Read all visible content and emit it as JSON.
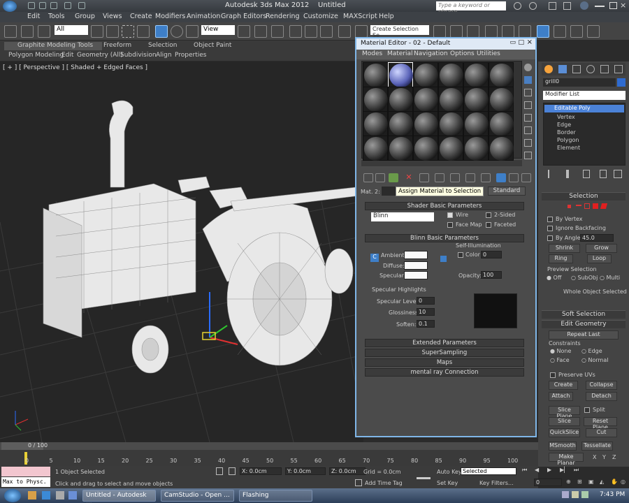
{
  "app": {
    "title": "Autodesk 3ds Max 2012",
    "doc": "Untitled",
    "search_placeholder": "Type a keyword or phrase"
  },
  "menu": [
    "Edit",
    "Tools",
    "Group",
    "Views",
    "Create",
    "Modifiers",
    "Animation",
    "Graph Editors",
    "Rendering",
    "Customize",
    "MAXScript",
    "Help"
  ],
  "toolbar": {
    "filter": "All",
    "refcoord": "View",
    "selection_set": "Create Selection Se"
  },
  "ribbon": {
    "tabs": [
      "Graphite Modeling Tools",
      "Freeform",
      "Selection",
      "Object Paint"
    ],
    "subtabs": [
      "Polygon Modeling",
      "Edit",
      "Geometry (All)",
      "Subdivision",
      "Align",
      "Properties"
    ]
  },
  "viewport": {
    "label": "[ + ] [ Perspective ] [ Shaded + Edged Faces ]"
  },
  "material_editor": {
    "title": "Material Editor - 02 - Default",
    "menu": [
      "Modes",
      "Material",
      "Navigation",
      "Options",
      "Utilities"
    ],
    "tooltip": "Assign Material to Selection",
    "mat_label": "Mat. 2:",
    "type_button": "Standard",
    "shader_basic": {
      "title": "Shader Basic Parameters",
      "shader": "Blinn",
      "wire": "Wire",
      "two_sided": "2-Sided",
      "face_map": "Face Map",
      "faceted": "Faceted"
    },
    "blinn": {
      "title": "Blinn Basic Parameters",
      "self_illum": "Self-Illumination",
      "color": "Color",
      "color_value": "0",
      "ambient": "Ambient:",
      "diffuse": "Diffuse:",
      "specular": "Specular:",
      "opacity": "Opacity:",
      "opacity_value": "100",
      "c_lock": "C"
    },
    "spec_highlights": {
      "title": "Specular Highlights",
      "level": "Specular Level:",
      "level_value": "0",
      "gloss": "Glossiness:",
      "gloss_value": "10",
      "soften": "Soften:",
      "soften_value": "0.1"
    },
    "rollouts": [
      "Extended Parameters",
      "SuperSampling",
      "Maps",
      "mental ray Connection"
    ]
  },
  "command_panel": {
    "object_name": "grill0",
    "modifier_list": "Modifier List",
    "stack": [
      "Editable Poly",
      "Vertex",
      "Edge",
      "Border",
      "Polygon",
      "Element"
    ],
    "selection": "Selection",
    "by_vertex": "By Vertex",
    "ignore_backfacing": "Ignore Backfacing",
    "by_angle": "By Angle:",
    "by_angle_value": "45.0",
    "shrink": "Shrink",
    "grow": "Grow",
    "ring": "Ring",
    "loop": "Loop",
    "preview_selection": "Preview Selection",
    "off": "Off",
    "subobj": "SubObj",
    "multi": "Multi",
    "whole_selected": "Whole Object Selected",
    "soft_selection": "Soft Selection",
    "edit_geometry": "Edit Geometry",
    "repeat_last": "Repeat Last",
    "constraints": "Constraints",
    "none": "None",
    "edge": "Edge",
    "face": "Face",
    "normal": "Normal",
    "preserve_uvs": "Preserve UVs",
    "create": "Create",
    "collapse": "Collapse",
    "attach": "Attach",
    "detach": "Detach",
    "slice_plane": "Slice Plane",
    "split": "Split",
    "slice": "Slice",
    "reset_plane": "Reset Plane",
    "quickslice": "QuickSlice",
    "cut": "Cut",
    "msmooth": "MSmooth",
    "tessellate": "Tessellate",
    "make_planar": "Make Planar",
    "x": "X",
    "y": "Y",
    "z": "Z"
  },
  "timeline": {
    "frame": "0 / 100",
    "ticks": [
      "0",
      "5",
      "10",
      "15",
      "20",
      "25",
      "30",
      "35",
      "40",
      "45",
      "50",
      "55",
      "60",
      "65",
      "70",
      "75",
      "80",
      "85",
      "90",
      "95",
      "100"
    ]
  },
  "status": {
    "maxscript": "Max to Physc.",
    "selected": "1 Object Selected",
    "prompt": "Click and drag to select and move objects",
    "x": "X: 0.0cm",
    "y": "Y: 0.0cm",
    "z": "Z: 0.0cm",
    "grid": "Grid = 0.0cm",
    "add_time_tag": "Add Time Tag",
    "auto_key": "Auto Key",
    "set_key": "Set Key",
    "key_mode": "Selected",
    "key_filters": "Key Filters...",
    "frame_field": "0"
  },
  "taskbar": {
    "tasks": [
      "Untitled - Autodesk ...",
      "CamStudio - Open ...",
      "Flashing"
    ],
    "clock": "7:43 PM"
  }
}
